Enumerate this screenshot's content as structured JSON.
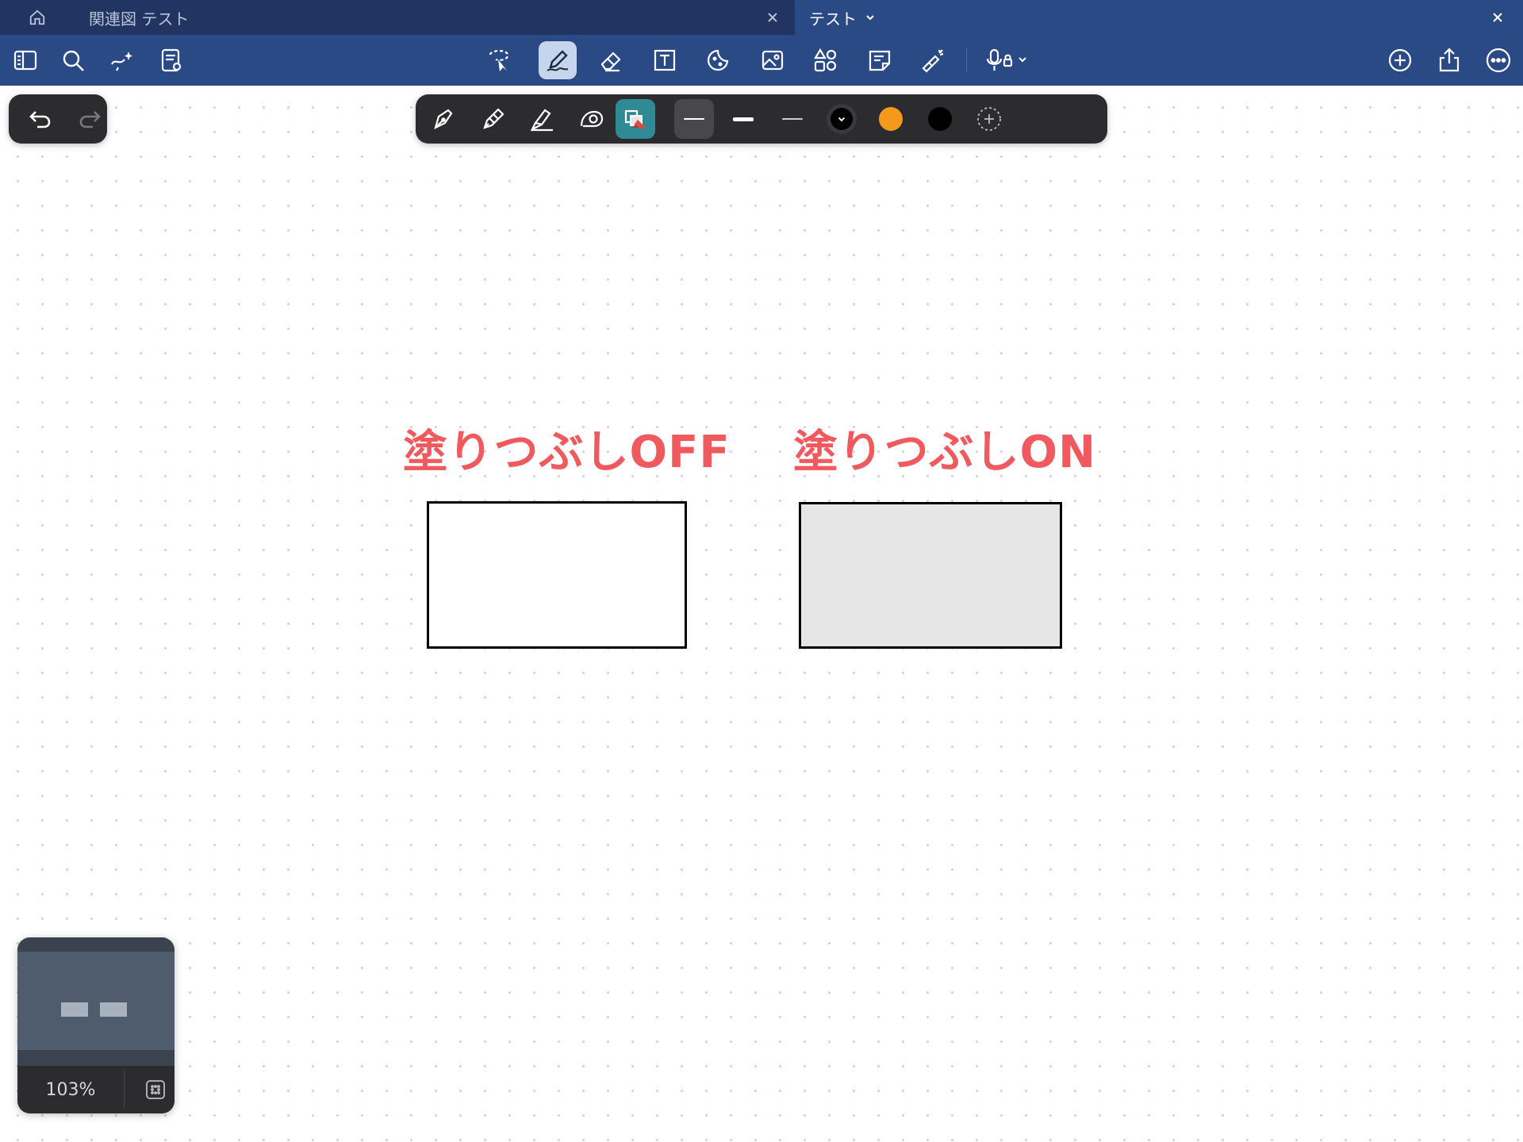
{
  "tabs": [
    {
      "label": "関連図 テスト",
      "active": false
    },
    {
      "label": "テスト",
      "active": true
    }
  ],
  "toolbar": {
    "left": [
      "sidebar-icon",
      "search-icon",
      "ai-lasso-icon",
      "page-settings-icon"
    ],
    "center": [
      "lasso-select-icon",
      "pen-icon",
      "eraser-icon",
      "text-box-icon",
      "sticker-icon",
      "image-icon",
      "shapes-icon",
      "sticky-note-icon",
      "laser-pointer-icon",
      "microphone-icon"
    ],
    "active_tool": "pen",
    "right": [
      "add-page-icon",
      "share-icon",
      "more-icon"
    ]
  },
  "palette": {
    "pens": [
      "fountain-pen-icon",
      "ball-pen-icon",
      "brush-pen-icon",
      "shape-tool-icon",
      "fill-tool-icon"
    ],
    "selected_pen": "fill-tool",
    "stroke_widths": [
      "thin",
      "medium",
      "fine"
    ],
    "selected_width": "thin",
    "colors": [
      "#000000",
      "#f39a1c",
      "#000000"
    ],
    "selected_color": "#000000"
  },
  "canvas": {
    "label_off": "塗りつぶしOFF",
    "label_on": "塗りつぶしON",
    "label_color": "#f05a5e",
    "fill_color_on": "#e6e6e6"
  },
  "minimap": {
    "zoom": "103%"
  },
  "colors": {
    "tabbar_bg": "#223462",
    "toolbar_bg": "#2a4a86",
    "palette_bg": "#2c2c2e",
    "selected_fill_tool": "#2f8a96"
  }
}
